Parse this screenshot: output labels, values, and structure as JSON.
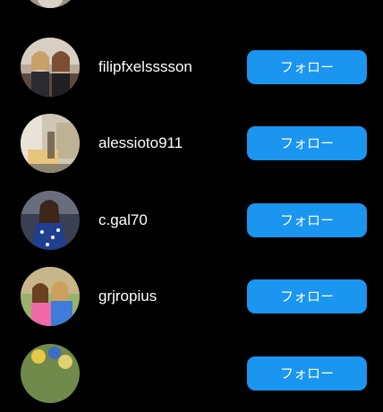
{
  "colors": {
    "background": "#000000",
    "follow_button": "#1a95f0",
    "text": "#ffffff"
  },
  "follow_label": "フォロー",
  "users": [
    {
      "username": "",
      "avatar": "profile-photo"
    },
    {
      "username": "filipfxelsssson",
      "avatar": "profile-photo"
    },
    {
      "username": "alessioto911",
      "avatar": "profile-photo"
    },
    {
      "username": "c.gal70",
      "avatar": "profile-photo"
    },
    {
      "username": "grjropius",
      "avatar": "profile-photo"
    },
    {
      "username": "",
      "avatar": "profile-photo"
    }
  ]
}
